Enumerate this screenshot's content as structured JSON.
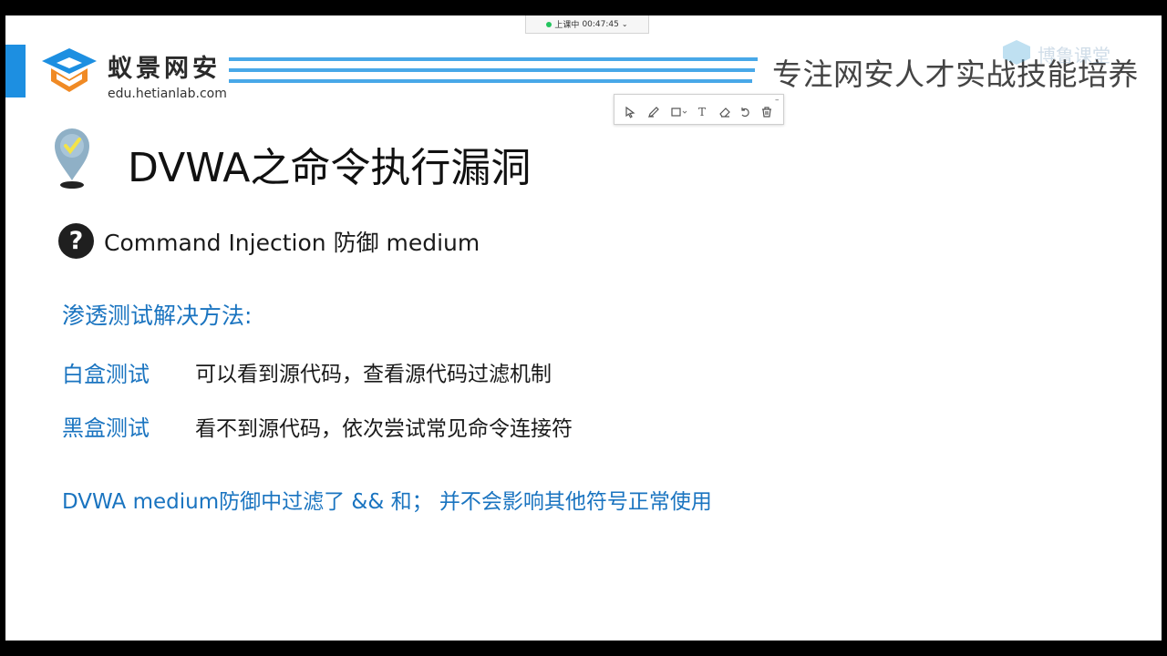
{
  "recording": {
    "status": "上课中",
    "time": "00:47:45"
  },
  "header": {
    "logo_cn": "蚁景网安",
    "logo_url": "edu.hetianlab.com",
    "slogan": "专注网安人才实战技能培养",
    "watermark": "博鲁课堂"
  },
  "toolbar": {
    "tools": [
      "select-icon",
      "pen-icon",
      "rectangle-icon",
      "text-icon",
      "eraser-icon",
      "undo-icon",
      "trash-icon"
    ],
    "text_tool_glyph": "T",
    "minimize": "–"
  },
  "content": {
    "title": "DVWA之命令执行漏洞",
    "subtitle": "Command Injection 防御 medium",
    "question_mark": "?",
    "methods_heading": "渗透测试解决方法:",
    "rows": [
      {
        "label": "白盒测试",
        "text": "可以看到源代码，查看源代码过滤机制"
      },
      {
        "label": "黑盒测试",
        "text": "看不到源代码，依次尝试常见命令连接符"
      }
    ],
    "note": "DVWA medium防御中过滤了 && 和；  并不会影响其他符号正常使用"
  },
  "colors": {
    "accent": "#1d8fe1",
    "text_blue": "#1a74c0",
    "stripe": "#48a8e8"
  }
}
